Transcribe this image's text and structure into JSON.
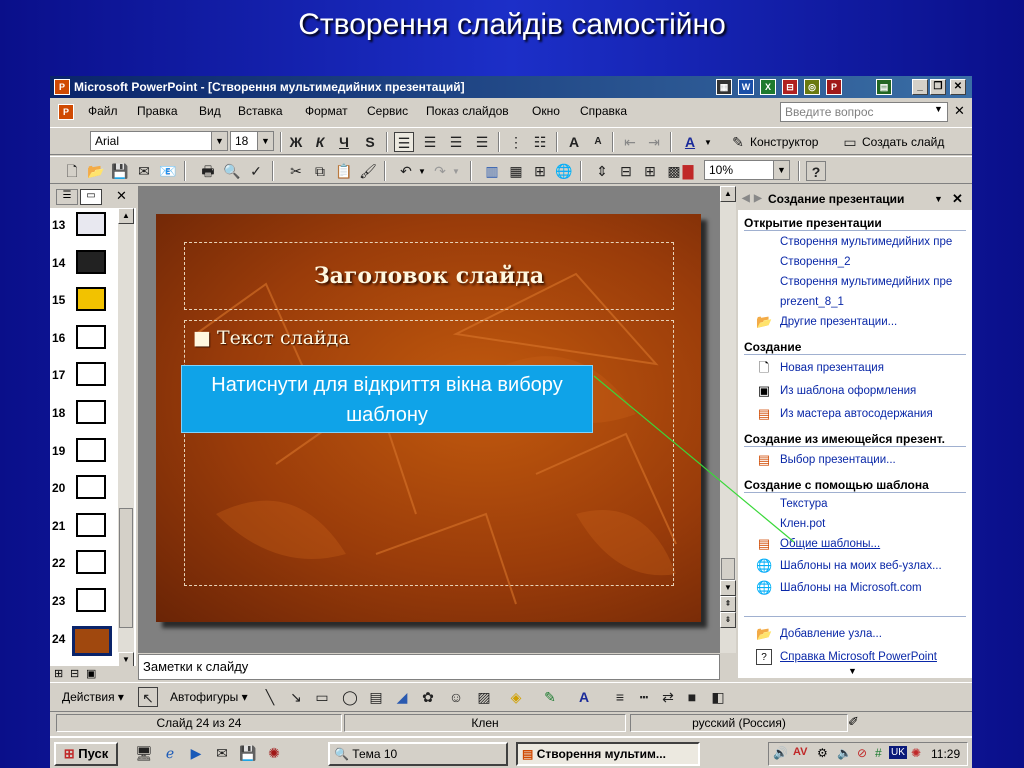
{
  "heading": "Створення слайдів самостійно",
  "window": {
    "title": "Microsoft PowerPoint - [Створення мультимедийних презентаций]",
    "min": "_",
    "restore": "❐",
    "close": "✕"
  },
  "menu": {
    "items": [
      "Файл",
      "Правка",
      "Вид",
      "Вставка",
      "Формат",
      "Сервис",
      "Показ слайдов",
      "Окно",
      "Справка"
    ],
    "search_placeholder": "Введите вопрос"
  },
  "format_toolbar": {
    "font": "Arial",
    "size": "18",
    "bold": "Ж",
    "italic": "К",
    "underline": "Ч",
    "shadow": "S",
    "designer": "Конструктор",
    "new_slide": "Создать слайд"
  },
  "standard_toolbar": {
    "zoom": "10%",
    "help": "?"
  },
  "thumbnails": {
    "numbers": [
      "13",
      "14",
      "15",
      "16",
      "17",
      "18",
      "19",
      "20",
      "21",
      "22",
      "23",
      "24"
    ]
  },
  "slide": {
    "title": "Заголовок слайда",
    "bullet": "Текст слайда"
  },
  "notes_placeholder": "Заметки к слайду",
  "task_pane": {
    "title": "Создание презентации",
    "open_section": "Открытие презентации",
    "recent": [
      "Створення мультимедийних пре",
      "Створення_2",
      "Створення мультимедийних пре",
      "prezent_8_1"
    ],
    "other": "Другие презентации...",
    "create_section": "Создание",
    "create_links": [
      "Новая презентация",
      "Из шаблона оформления",
      "Из мастера автосодержания"
    ],
    "existing_section": "Создание из имеющейся презент.",
    "existing_link": "Выбор презентации...",
    "template_section": "Создание с помощью шаблона",
    "templates": [
      "Текстура",
      "Клен.pot"
    ],
    "template_links": [
      "Общие шаблоны...",
      "Шаблоны на моих веб-узлах...",
      "Шаблоны на Microsoft.com"
    ],
    "add_node": "Добавление узла...",
    "help": "Справка Microsoft PowerPoint"
  },
  "callout": "Натиснути для відкриття вікна вибору шаблону",
  "drawing_toolbar": {
    "actions": "Действия",
    "autoshapes": "Автофигуры"
  },
  "status": {
    "slide": "Слайд 24 из 24",
    "design": "Клен",
    "language": "русский (Россия)"
  },
  "taskbar": {
    "start": "Пуск",
    "tasks": [
      "Тема 10",
      "Створення мультим..."
    ],
    "lang": "UK",
    "time": "11:29"
  }
}
